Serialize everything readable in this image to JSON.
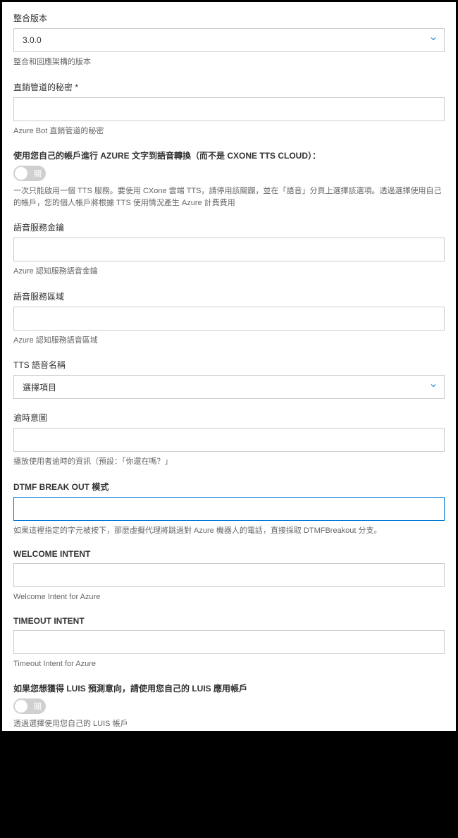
{
  "fields": {
    "version": {
      "label": "整合版本",
      "value": "3.0.0",
      "helper": "整合和回應架構的版本"
    },
    "secret": {
      "label": "直銷管道的秘密 *",
      "value": "",
      "helper": "Azure Bot 直銷管道的秘密"
    },
    "azureTts": {
      "label": "使用您自己的帳戶進行 AZURE 文字到語音轉換（而不是 CXONE TTS CLOUD）：",
      "toggleState": "關",
      "helper": "一次只能啟用一個 TTS 服務。要使用 CXone 雲端 TTS，請停用該關闢，並在「語音」分頁上選擇該選項。透過選擇使用自己的帳戶，您的個人帳戶將根據 TTS 使用情況產生 Azure 計費費用"
    },
    "speechKey": {
      "label": "語音服務金鑰",
      "value": "",
      "helper": "Azure 認知服務語音金鑰"
    },
    "speechRegion": {
      "label": "語音服務區域",
      "value": "",
      "helper": "Azure 認知服務語音區域"
    },
    "ttsVoice": {
      "label": "TTS 語音名稱",
      "value": "選擇項目"
    },
    "timeoutPrompt": {
      "label": "逾時意圖",
      "value": "",
      "helper": "播放使用者逾時的資訊（預設：「你還在嗎？」"
    },
    "dtmf": {
      "label": "DTMF BREAK OUT 模式",
      "value": "",
      "helper": "如果這裡指定的字元被按下，那麼虛擬代理將跳過對 Azure 機器人的電話，直接採取 DTMFBreakout 分支。"
    },
    "welcomeIntent": {
      "label": "WELCOME INTENT",
      "value": "",
      "helper": "Welcome Intent for Azure"
    },
    "timeoutIntent": {
      "label": "TIMEOUT INTENT",
      "value": "",
      "helper": "Timeout Intent for Azure"
    },
    "luisAccount": {
      "label": "如果您想獲得 LUIS 預測意向，請使用您自己的 LUIS 應用帳戶",
      "toggleState": "關",
      "helper": "透過選擇使用您自己的 LUIS 帳戶"
    }
  }
}
